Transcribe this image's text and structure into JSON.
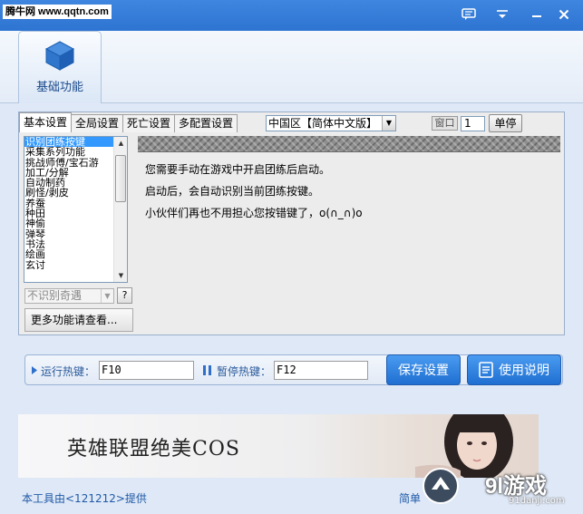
{
  "titlebar": {
    "badge": "腾牛网 www.qqtn.com",
    "buttons": [
      "feedback-icon",
      "menu-icon",
      "minimize-icon",
      "close-icon"
    ]
  },
  "function_tab": {
    "label": "基础功能",
    "icon": "cube-icon"
  },
  "tabs": [
    "基本设置",
    "全局设置",
    "死亡设置",
    "多配置设置"
  ],
  "region": {
    "value": "中国区【简体中文版】"
  },
  "window": {
    "label": "窗口",
    "value": "1",
    "single_stop_label": "单停"
  },
  "list": {
    "items": [
      "识别团练按键",
      "采集系列功能",
      "挑战师傅/宝石游",
      "加工/分解",
      "自动制药",
      "刷怪/剥皮",
      "养蚕",
      "种田",
      "神偷",
      "弹琴",
      "书法",
      "绘画",
      "玄讨"
    ],
    "selected_index": 0
  },
  "encounter_select": {
    "value": "不识别奇遇"
  },
  "help_label": "?",
  "more_label": "更多功能请查看...",
  "content": {
    "lines": [
      "您需要手动在游戏中开启团练后启动。",
      "启动后，会自动识别当前团练按键。",
      "小伙伴们再也不用担心您按错键了，o(∩_∩)o"
    ]
  },
  "hotkeys": {
    "run_label": "运行热键：",
    "run_value": "F10",
    "pause_label": "暂停热键：",
    "pause_value": "F12"
  },
  "actions": {
    "save_label": "保存设置",
    "manual_label": "使用说明"
  },
  "banner": {
    "text": "英雄联盟绝美COS"
  },
  "footer": {
    "credit": "本工具由<121212>提供",
    "right": "简单"
  },
  "watermark": {
    "brand": "9l游戏",
    "site": "91danji.com"
  },
  "colors": {
    "title_bar": "#2e74d1",
    "button_blue": "#1f6fd2",
    "selection": "#3399ff"
  }
}
